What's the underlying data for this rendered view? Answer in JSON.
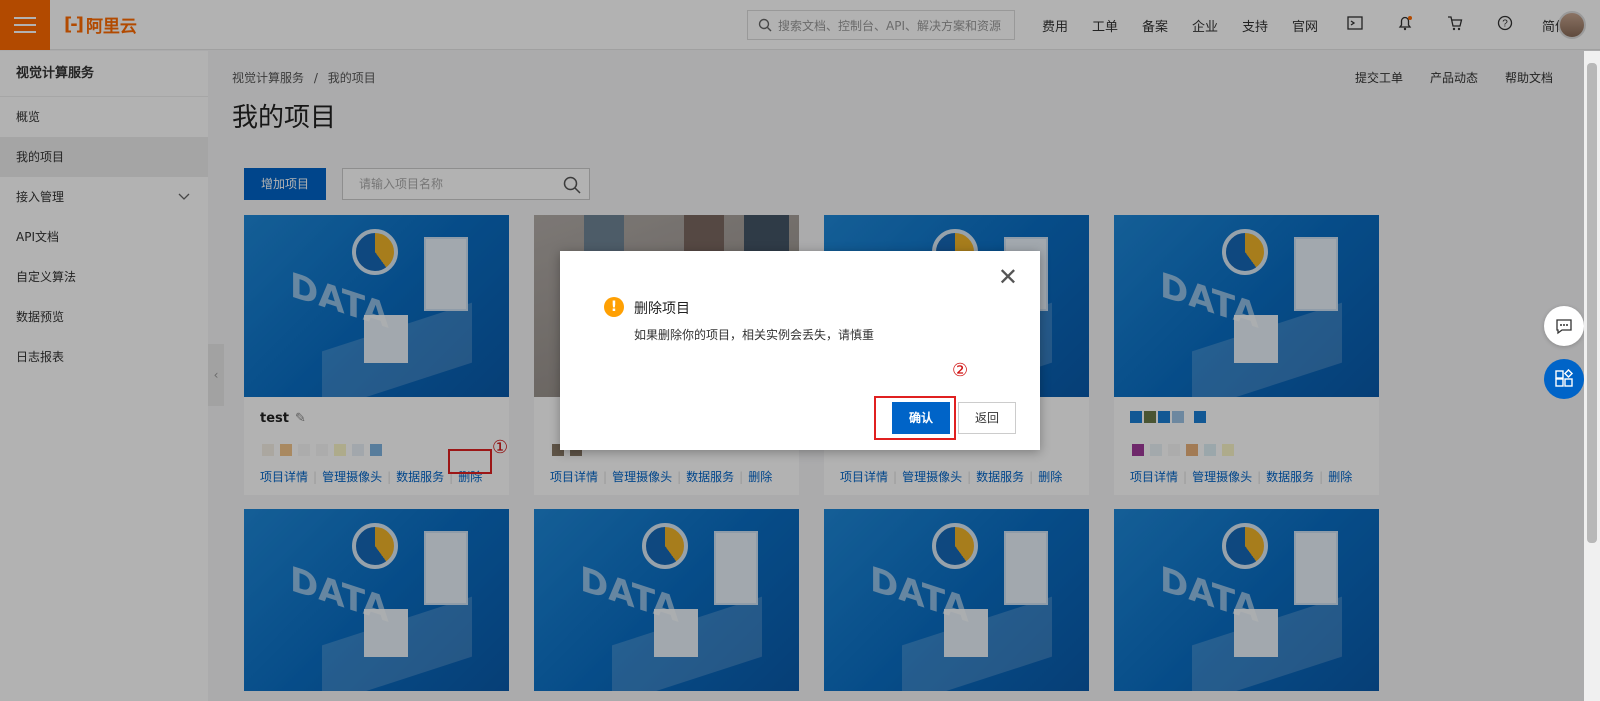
{
  "topbar": {
    "logo": "阿里云",
    "search_placeholder": "搜索文档、控制台、API、解决方案和资源",
    "nav": [
      "费用",
      "工单",
      "备案",
      "企业",
      "支持",
      "官网"
    ],
    "lang": "简体"
  },
  "sidebar": {
    "title": "视觉计算服务",
    "items": [
      "概览",
      "我的项目",
      "接入管理",
      "API文档",
      "自定义算法",
      "数据预览",
      "日志报表"
    ],
    "active_index": 1
  },
  "breadcrumb": [
    "视觉计算服务",
    "我的项目"
  ],
  "breadcrumb_sep": "/",
  "right_links": [
    "提交工单",
    "产品动态",
    "帮助文档"
  ],
  "page_title": "我的项目",
  "add_button": "增加项目",
  "project_search_placeholder": "请输入项目名称",
  "cards": [
    {
      "name": "test",
      "links": [
        "项目详情",
        "管理摄像头",
        "数据服务",
        "删除"
      ]
    },
    {
      "name": "",
      "links": [
        "项目详情",
        "管理摄像头",
        "数据服务",
        "删除"
      ]
    },
    {
      "name": "",
      "links": [
        "项目详情",
        "管理摄像头",
        "数据服务",
        "删除"
      ]
    },
    {
      "name": "",
      "links": [
        "项目详情",
        "管理摄像头",
        "数据服务",
        "删除"
      ]
    }
  ],
  "dialog": {
    "title": "删除项目",
    "message": "如果删除你的项目，相关实例会丢失，请慎重",
    "confirm": "确认",
    "cancel": "返回"
  },
  "annotations": [
    "①",
    "②"
  ],
  "colors": {
    "brand": "#ff6a00",
    "primary": "#0064c8",
    "warning": "#ffa003",
    "highlight": "#e02020"
  }
}
